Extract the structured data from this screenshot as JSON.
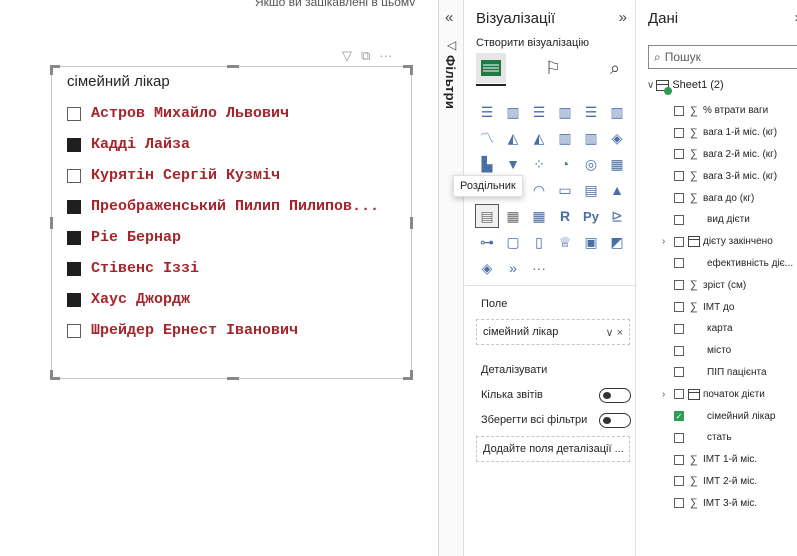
{
  "top_cut_text": "Якщо ви зацікавлені в цьому",
  "canvas": {
    "toolbar_icons": [
      "filter-icon",
      "focus-mode-icon",
      "more-options-icon"
    ],
    "slicer": {
      "title": "сімейний лікар",
      "items": [
        {
          "label": "Астров Михайло Львович",
          "checked": false
        },
        {
          "label": "Кадді Лайза",
          "checked": true
        },
        {
          "label": "Курятін Сергій Кузміч",
          "checked": false
        },
        {
          "label": "Преображенський Пилип Пилипов...",
          "checked": true
        },
        {
          "label": "Ріе Бернар",
          "checked": true
        },
        {
          "label": "Стівенс Іззі",
          "checked": true
        },
        {
          "label": "Хаус Джордж",
          "checked": true
        },
        {
          "label": "Шрейдер Ернест Іванович",
          "checked": false
        }
      ],
      "item_color": "#a4262c"
    }
  },
  "filters_pane": {
    "collapse_glyph": "«",
    "label": "Фільтри"
  },
  "visualizations": {
    "title": "Візуалізації",
    "expand_glyph": "»",
    "build_label": "Створити візуалізацію",
    "tooltip": "Роздільник",
    "field_section": "Поле",
    "field_value": "сімейний лікар",
    "drill_section": "Деталізувати",
    "cross_report": "Кілька звітів",
    "keep_filters": "Зберегти всі фільтри",
    "add_drill": "Додайте поля деталізації ..."
  },
  "data_pane": {
    "title": "Дані",
    "expand_glyph": "»",
    "search_placeholder": "Пошук",
    "table_name": "Sheet1 (2)",
    "fields": [
      {
        "name": "% втрати ваги",
        "type": "sigma",
        "checked": false,
        "expandable": false
      },
      {
        "name": "вага 1-й міс. (кг)",
        "type": "sigma",
        "checked": false,
        "expandable": false
      },
      {
        "name": "вага 2-й міс. (кг)",
        "type": "sigma",
        "checked": false,
        "expandable": false
      },
      {
        "name": "вага 3-й міс. (кг)",
        "type": "sigma",
        "checked": false,
        "expandable": false
      },
      {
        "name": "вага до (кг)",
        "type": "sigma",
        "checked": false,
        "expandable": false
      },
      {
        "name": "вид дієти",
        "type": "text",
        "checked": false,
        "expandable": false
      },
      {
        "name": "дієту закінчено",
        "type": "date",
        "checked": false,
        "expandable": true
      },
      {
        "name": "ефективність діє...",
        "type": "text",
        "checked": false,
        "expandable": false
      },
      {
        "name": "зріст (см)",
        "type": "sigma",
        "checked": false,
        "expandable": false
      },
      {
        "name": "ІМТ до",
        "type": "sigma",
        "checked": false,
        "expandable": false
      },
      {
        "name": "карта",
        "type": "text",
        "checked": false,
        "expandable": false
      },
      {
        "name": "місто",
        "type": "text",
        "checked": false,
        "expandable": false
      },
      {
        "name": "ПІП пацієнта",
        "type": "text",
        "checked": false,
        "expandable": false
      },
      {
        "name": "початок дієти",
        "type": "date",
        "checked": false,
        "expandable": true
      },
      {
        "name": "сімейний лікар",
        "type": "text",
        "checked": true,
        "expandable": false
      },
      {
        "name": "стать",
        "type": "text",
        "checked": false,
        "expandable": false
      },
      {
        "name": "ІМТ 1-й міс.",
        "type": "sigma",
        "checked": false,
        "expandable": false
      },
      {
        "name": "ІМТ 2-й міс.",
        "type": "sigma",
        "checked": false,
        "expandable": false
      },
      {
        "name": "ІМТ 3-й міс.",
        "type": "sigma",
        "checked": false,
        "expandable": false
      }
    ]
  }
}
